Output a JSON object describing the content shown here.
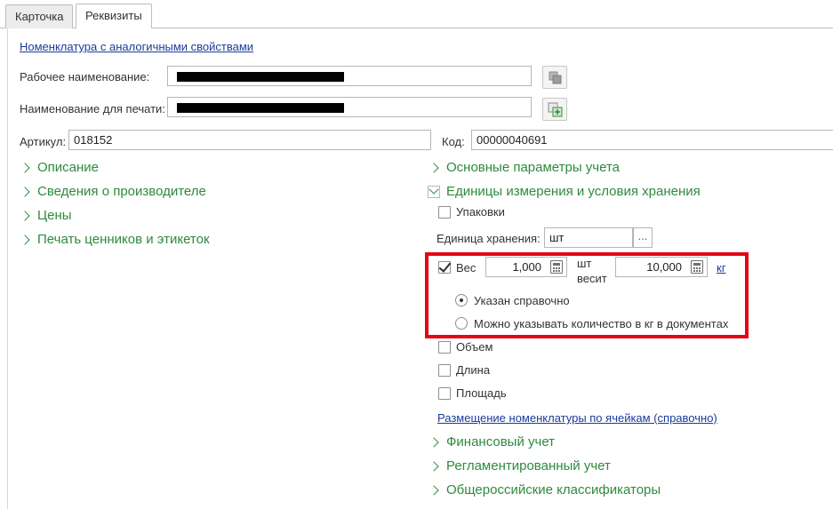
{
  "tabs": [
    {
      "label": "Карточка",
      "active": false
    },
    {
      "label": "Реквизиты",
      "active": true
    }
  ],
  "similar_link": "Номенклатура с аналогичными свойствами",
  "working_name": {
    "label": "Рабочее наименование:"
  },
  "print_name": {
    "label": "Наименование для печати:"
  },
  "article": {
    "label": "Артикул:",
    "value": "018152"
  },
  "code": {
    "label": "Код:",
    "value": "00000040691"
  },
  "left_groups": [
    "Описание",
    "Сведения о производителе",
    "Цены",
    "Печать ценников и этикеток"
  ],
  "right_groups": {
    "main_params": "Основные параметры учета",
    "units": "Единицы измерения и условия хранения",
    "financial": "Финансовый учет",
    "regulated": "Регламентированный учет",
    "classifiers": "Общероссийские классификаторы"
  },
  "units_section": {
    "packages_label": "Упаковки",
    "storage_unit_label": "Единица хранения:",
    "storage_unit_value": "шт",
    "select_button": "...",
    "weight": {
      "label": "Вес",
      "checked": true,
      "qty": "1,000",
      "unit_line1": "шт",
      "unit_line2": "весит",
      "weight_value": "10,000",
      "weight_unit": "кг"
    },
    "radio_reference": "Указан справочно",
    "radio_documents": "Можно указывать количество в кг в документах",
    "volume_label": "Объем",
    "length_label": "Длина",
    "area_label": "Площадь",
    "cells_link": "Размещение номенклатуры по ячейкам (справочно)"
  },
  "colors": {
    "group_green": "#2e8a3e",
    "link_blue": "#1a3c9a",
    "highlight_red": "#e30613"
  }
}
